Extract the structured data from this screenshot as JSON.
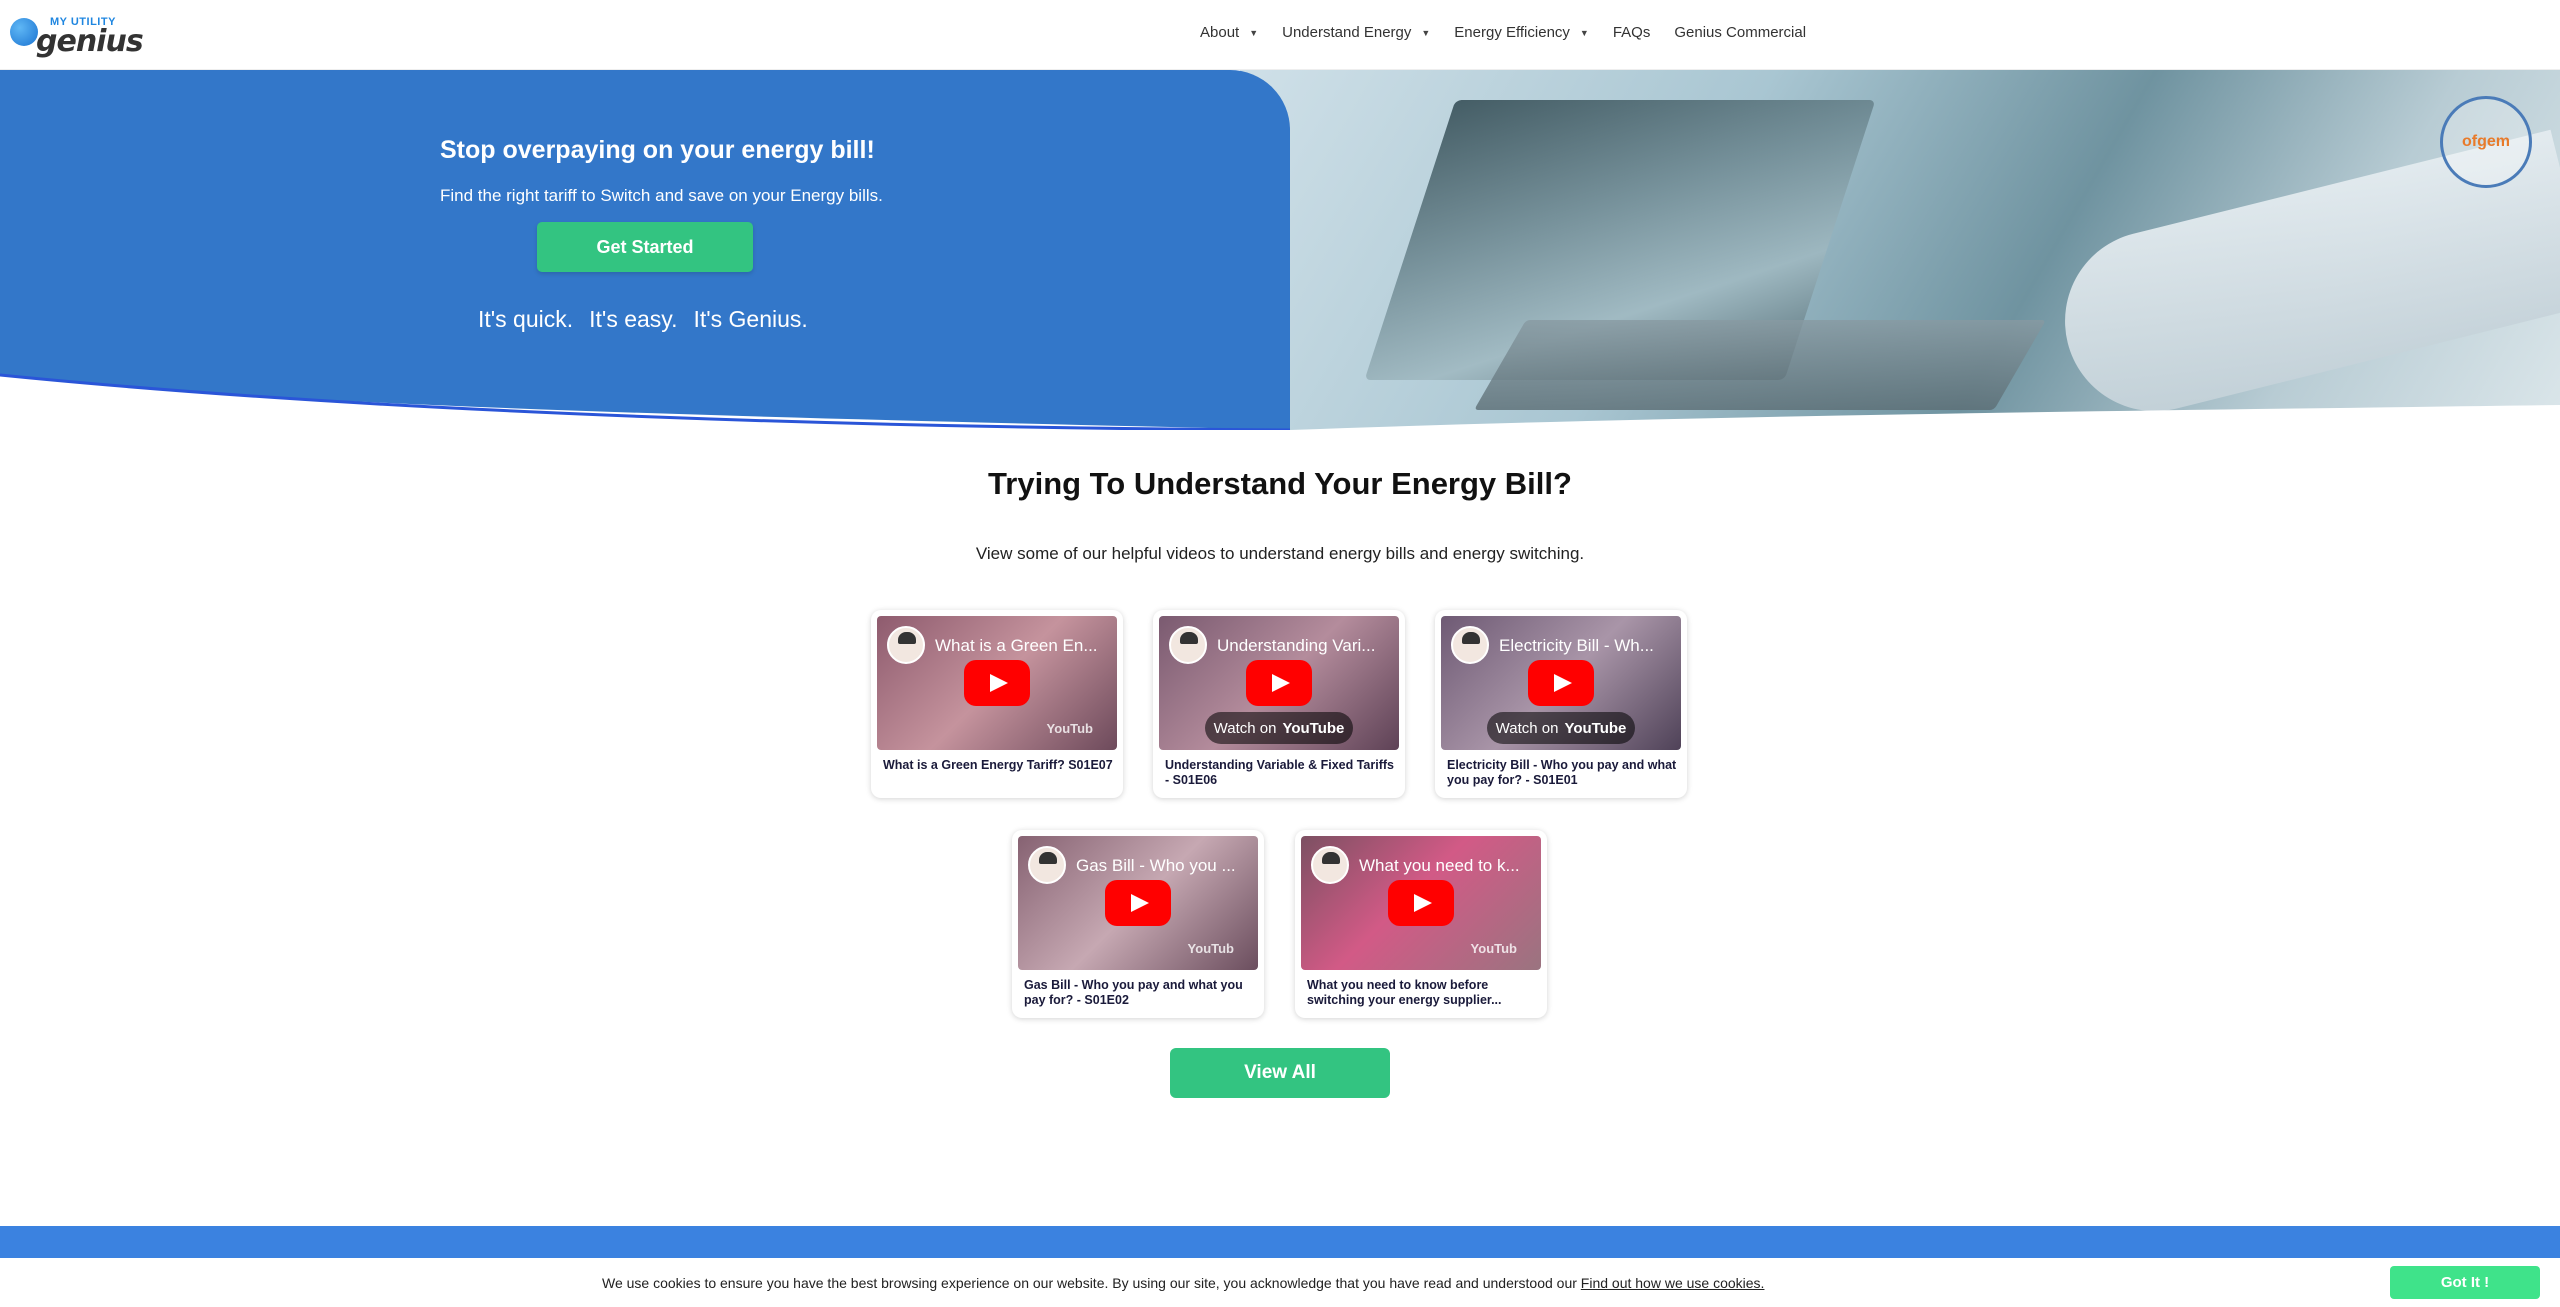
{
  "logo": {
    "top_text": "MY UTILITY",
    "word": "genius"
  },
  "nav": {
    "items": [
      {
        "label": "About",
        "has_dropdown": true
      },
      {
        "label": "Understand Energy",
        "has_dropdown": true
      },
      {
        "label": "Energy Efficiency",
        "has_dropdown": true
      },
      {
        "label": "FAQs",
        "has_dropdown": false
      },
      {
        "label": "Genius Commercial",
        "has_dropdown": false
      }
    ],
    "caret": "▼"
  },
  "hero": {
    "title": "Stop overpaying on your energy bill!",
    "subtitle": "Find the right tariff to Switch and save on your Energy bills.",
    "cta": "Get Started",
    "tagline": [
      "It's quick.",
      "It's easy.",
      "It's Genius."
    ],
    "badge_text": "ofgem"
  },
  "section": {
    "title": "Trying To Understand Your Energy Bill?",
    "subtitle": "View some of our helpful videos to understand energy bills and energy switching."
  },
  "videos": [
    {
      "thumb_title": "What is a Green En...",
      "label": "What is a Green Energy Tariff? S01E07",
      "watch_on": "",
      "yt_corner": "YouTub"
    },
    {
      "thumb_title": "Understanding Vari...",
      "label": "Understanding Variable & Fixed Tariffs - S01E06",
      "watch_on": "Watch on",
      "yt_corner": ""
    },
    {
      "thumb_title": "Electricity Bill - Wh...",
      "label": "Electricity Bill - Who you pay and what you pay for? - S01E01",
      "watch_on": "Watch on",
      "yt_corner": ""
    },
    {
      "thumb_title": "Gas Bill - Who you ...",
      "label": "Gas Bill - Who you pay and what you pay for? - S01E02",
      "watch_on": "",
      "yt_corner": "YouTub"
    },
    {
      "thumb_title": "What you need to k...",
      "label": "What you need to know before switching your energy supplier...",
      "watch_on": "",
      "yt_corner": "YouTub"
    }
  ],
  "yt_logo": "YouTube",
  "view_all": "View All",
  "cookie": {
    "text": "We use cookies to ensure you have the best browsing experience on our website. By using our site, you acknowledge that you have read and understood our",
    "link": "Find out how we use cookies.",
    "button": "Got It !"
  },
  "colors": {
    "brand_blue": "#3377c9",
    "cta_green": "#33c481",
    "cookie_green": "#3fe38a",
    "footer_blue": "#3b82e0"
  }
}
